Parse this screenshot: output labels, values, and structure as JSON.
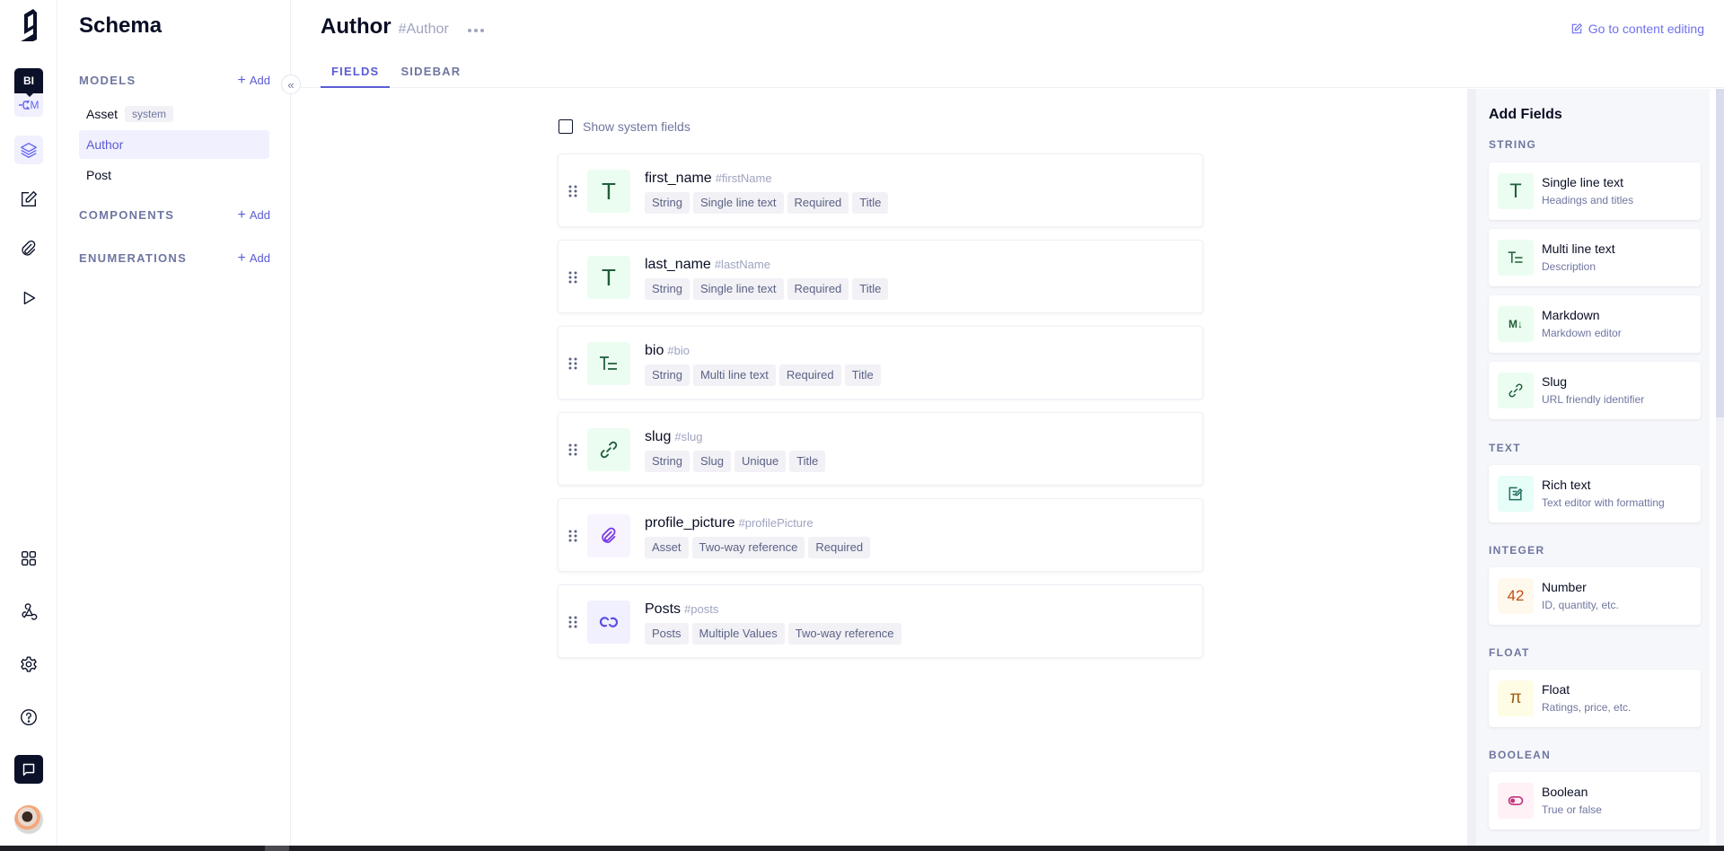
{
  "rail": {
    "env_badge": "BI",
    "env_branch": "M",
    "items": [
      {
        "name": "schema",
        "icon": "layers-icon",
        "active": true
      },
      {
        "name": "content",
        "icon": "edit-icon"
      },
      {
        "name": "assets",
        "icon": "paperclip-icon"
      },
      {
        "name": "playground",
        "icon": "play-icon"
      },
      {
        "name": "apps",
        "icon": "grid-icon"
      },
      {
        "name": "webhooks",
        "icon": "webhook-icon"
      },
      {
        "name": "settings",
        "icon": "gear-icon"
      },
      {
        "name": "help",
        "icon": "help-icon"
      },
      {
        "name": "chat",
        "icon": "chat-icon"
      }
    ]
  },
  "schema_sidebar": {
    "title": "Schema",
    "models_label": "MODELS",
    "components_label": "COMPONENTS",
    "enumerations_label": "ENUMERATIONS",
    "add_label": "Add",
    "models": [
      {
        "name": "Asset",
        "badge": "system"
      },
      {
        "name": "Author",
        "selected": true
      },
      {
        "name": "Post"
      }
    ]
  },
  "header": {
    "title": "Author",
    "api_id": "#Author",
    "go_to_content": "Go to content editing",
    "tabs": [
      {
        "label": "FIELDS",
        "active": true
      },
      {
        "label": "SIDEBAR"
      }
    ]
  },
  "main": {
    "show_system_fields": "Show system fields",
    "show_system_fields_checked": false,
    "fields": [
      {
        "name": "first_name",
        "api_id": "#firstName",
        "icon": "text-icon",
        "tags": [
          "String",
          "Single line text",
          "Required",
          "Title"
        ]
      },
      {
        "name": "last_name",
        "api_id": "#lastName",
        "icon": "text-icon",
        "tags": [
          "String",
          "Single line text",
          "Required",
          "Title"
        ]
      },
      {
        "name": "bio",
        "api_id": "#bio",
        "icon": "multiline-text-icon",
        "tags": [
          "String",
          "Multi line text",
          "Required",
          "Title"
        ]
      },
      {
        "name": "slug",
        "api_id": "#slug",
        "icon": "link-icon",
        "tags": [
          "String",
          "Slug",
          "Unique",
          "Title"
        ]
      },
      {
        "name": "profile_picture",
        "api_id": "#profilePicture",
        "icon": "paperclip-icon",
        "tags": [
          "Asset",
          "Two-way reference",
          "Required"
        ]
      },
      {
        "name": "Posts",
        "api_id": "#posts",
        "icon": "relation-icon",
        "tags": [
          "Posts",
          "Multiple Values",
          "Two-way reference"
        ]
      }
    ]
  },
  "add_fields": {
    "title": "Add Fields",
    "categories": [
      {
        "label": "STRING",
        "types": [
          {
            "name": "Single line text",
            "desc": "Headings and titles",
            "icon": "text-icon"
          },
          {
            "name": "Multi line text",
            "desc": "Description",
            "icon": "multiline-text-icon"
          },
          {
            "name": "Markdown",
            "desc": "Markdown editor",
            "icon": "markdown-icon",
            "glyph": "M↓"
          },
          {
            "name": "Slug",
            "desc": "URL friendly identifier",
            "icon": "link-icon"
          }
        ]
      },
      {
        "label": "TEXT",
        "types": [
          {
            "name": "Rich text",
            "desc": "Text editor with formatting",
            "icon": "rich-text-icon"
          }
        ]
      },
      {
        "label": "INTEGER",
        "types": [
          {
            "name": "Number",
            "desc": "ID, quantity, etc.",
            "icon": "number-icon",
            "glyph": "42"
          }
        ]
      },
      {
        "label": "FLOAT",
        "types": [
          {
            "name": "Float",
            "desc": "Ratings, price, etc.",
            "icon": "pi-icon",
            "glyph": "π"
          }
        ]
      },
      {
        "label": "BOOLEAN",
        "types": [
          {
            "name": "Boolean",
            "desc": "True or false",
            "icon": "toggle-icon"
          }
        ]
      }
    ]
  },
  "colors": {
    "accent": "#5b5bd6",
    "dark": "#0b1129",
    "string_icon_bg": "#ebfdf0",
    "asset_icon_bg": "#f8f4fe",
    "relation_icon_bg": "#f0f0fe"
  }
}
